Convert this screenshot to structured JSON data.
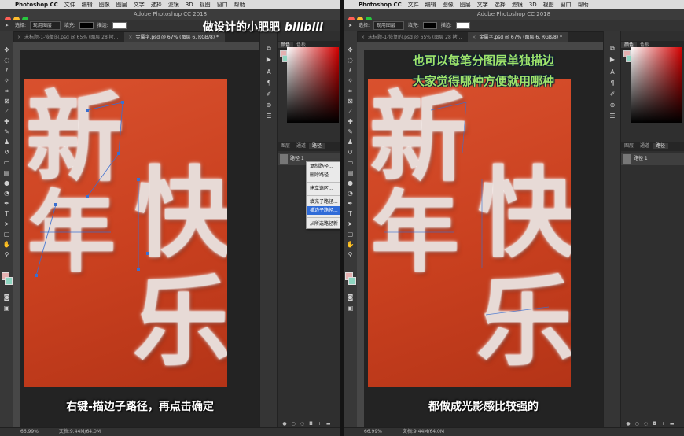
{
  "menubar": {
    "app": "Photoshop CC",
    "items": [
      "文件",
      "编辑",
      "图像",
      "图层",
      "文字",
      "选择",
      "滤镜",
      "3D",
      "视图",
      "窗口",
      "帮助"
    ]
  },
  "left": {
    "window_title": "Adobe Photoshop CC 2018",
    "options": {
      "select_label": "选择:",
      "select_value": "现用图层",
      "fill_label": "填充:",
      "stroke_label": "描边:"
    },
    "tabs": [
      "未标题-1-恢复的.psd @ 65% (图层 28 拷...",
      "金属字.psd @ 67% (图层 6, RGB/8) *"
    ],
    "canvas_text": {
      "xin": "新",
      "nian": "年",
      "kuai": "快",
      "le": "乐"
    },
    "subtitle": "右键-描边子路径，再点击确定",
    "panel_tabs_top": [
      "颜色",
      "色板"
    ],
    "panel_tabs_bottom": [
      "图层",
      "通道",
      "路径"
    ],
    "path_name": "路径 1",
    "context_menu": [
      "复制路径...",
      "删除路径",
      "建立选区...",
      "填充子路径...",
      "描边子路径...",
      "从所选路径新"
    ],
    "context_highlight_index": 4,
    "status": {
      "zoom": "66.99%",
      "doc": "文档:9.44M/64.0M"
    }
  },
  "right": {
    "window_title": "Adobe Photoshop CC 2018",
    "options": {
      "select_label": "选择:",
      "select_value": "现用图层",
      "fill_label": "填充:",
      "stroke_label": "描边:"
    },
    "tabs": [
      "未标题-1-恢复的.psd @ 65% (图层 28 拷...",
      "金属字.psd @ 67% (图层 6, RGB/8) *"
    ],
    "canvas_text": {
      "xin": "新",
      "nian": "年",
      "kuai": "快",
      "le": "乐"
    },
    "overlay_line1": "也可以每笔分图层单独描边",
    "overlay_line2": "大家觉得哪种方便就用哪种",
    "subtitle": "都做成光影感比较强的",
    "panel_tabs_top": [
      "颜色",
      "色板"
    ],
    "panel_tabs_bottom": [
      "图层",
      "通道",
      "路径"
    ],
    "path_name": "路径 1",
    "status": {
      "zoom": "66.99%",
      "doc": "文档:9.44M/64.0M"
    }
  },
  "watermark": {
    "text": "做设计的小肥肥",
    "logo": "bilibili"
  },
  "colors": {
    "canvas": "#c9401f",
    "stroke_glow": "#e7dad6",
    "path_line": "#3a6fd0",
    "overlay_text": "#9fe46a",
    "menu_highlight": "#2f6bd8"
  }
}
